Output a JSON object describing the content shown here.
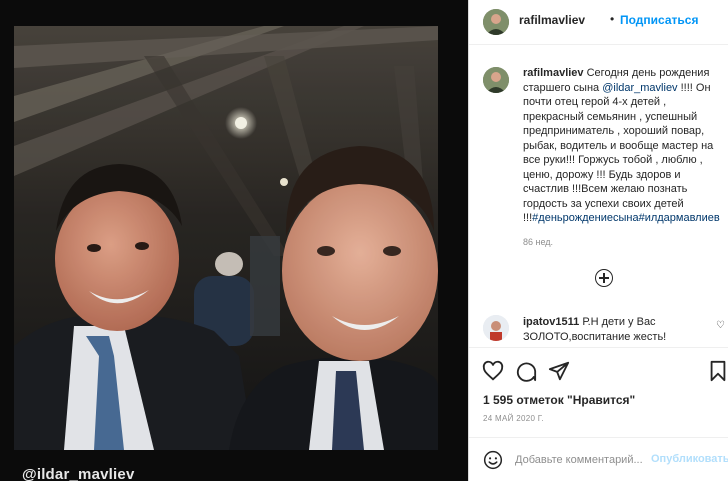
{
  "post": {
    "image_overlay_text": "@ildar_mavliev"
  },
  "header": {
    "username": "rafilmavliev",
    "dot": "•",
    "follow_label": "Подписаться"
  },
  "caption": {
    "username": "rafilmavliev",
    "text_1": "Сегодня день рождения старшего сына ",
    "mention": "@ildar_mavliev",
    "text_2": " !!!! Он почти отец герой 4-х детей , прекрасный семьянин , успешный предприниматель , хороший повар, рыбак, водитель и вообще мастер на все руки!!! Горжусь тобой , люблю , ценю, дорожу !!! Будь здоров и счастлив !!!Всем желаю познать гордость за успехи своих детей !!!",
    "hashtags": "#деньрождениесына#илдармавлиев",
    "time": "86 нед."
  },
  "comment": {
    "username": "ipatov1511",
    "text": " Р.Н дети у Вас ЗОЛОТО,воспитание жесть!"
  },
  "likes_text": "1 595 отметок \"Нравится\"",
  "date_text": "24 МАЙ 2020 Г.",
  "add_comment": {
    "placeholder": "Добавьте комментарий...",
    "publish_label": "Опубликовать"
  },
  "colors": {
    "accent": "#0095f6",
    "publish_disabled": "#b2dffc",
    "link": "#00376b",
    "meta_gray": "#8e8e8e"
  },
  "icons": [
    "heart-icon",
    "comment-icon",
    "share-icon",
    "bookmark-icon",
    "add-circle-icon",
    "emoji-icon"
  ]
}
